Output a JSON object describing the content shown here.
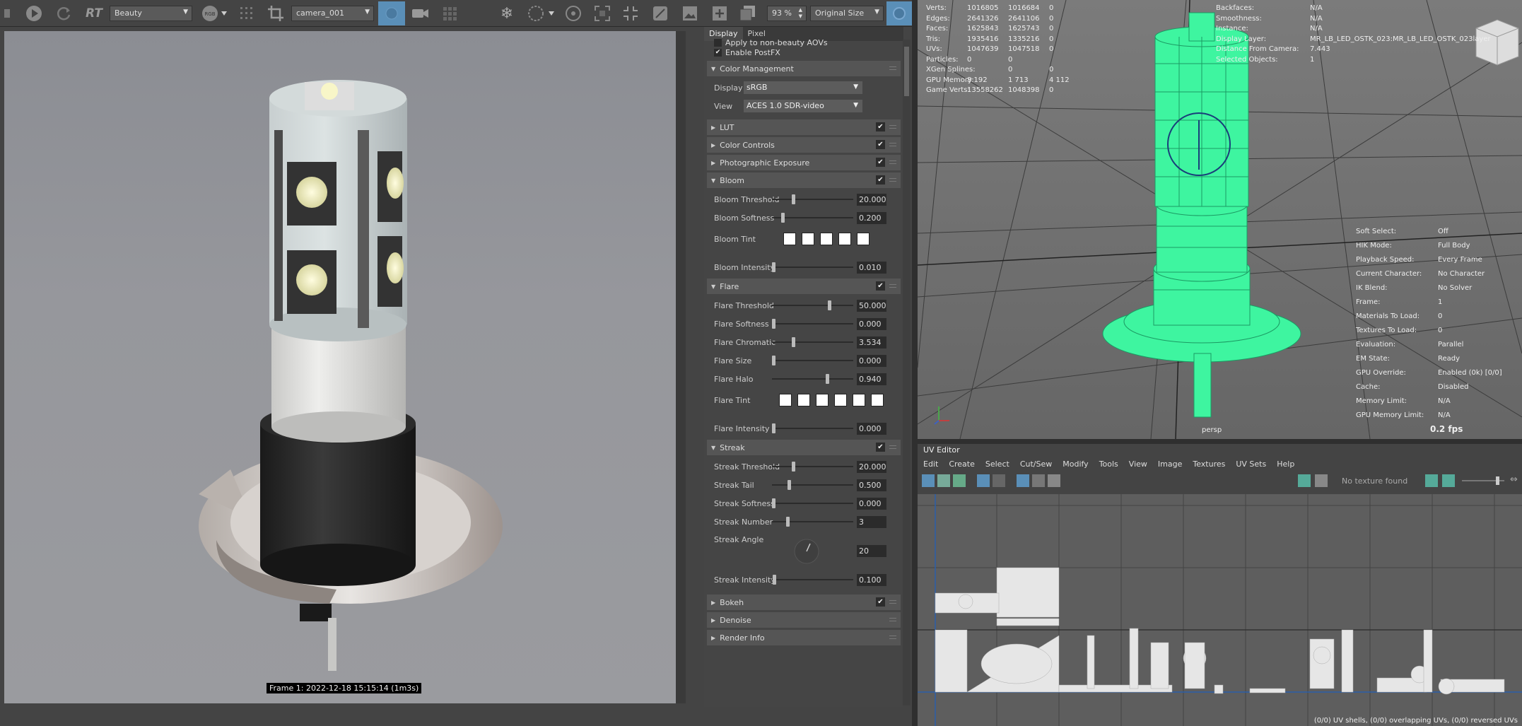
{
  "toolbar": {
    "renderer_label": "RT",
    "beauty": "Beauty",
    "rgb": "RGB",
    "camera": "camera_001",
    "zoom": "93 %",
    "size": "Original Size"
  },
  "render": {
    "caption": "Frame 1: 2022-12-18 15:15:14 (1m3s)"
  },
  "panel": {
    "tabs": [
      "Display",
      "Pixel"
    ],
    "apply_aovs": "Apply to non-beauty AOVs",
    "enable_postfx": "Enable PostFX",
    "color_management": "Color Management",
    "display_label": "Display",
    "display_value": "sRGB",
    "view_label": "View",
    "view_value": "ACES 1.0 SDR-video",
    "lut": "LUT",
    "color_controls": "Color Controls",
    "photo_exposure": "Photographic Exposure",
    "bloom": {
      "title": "Bloom",
      "threshold_label": "Bloom Threshold",
      "threshold": "20.000",
      "softness_label": "Bloom Softness",
      "softness": "0.200",
      "tint_label": "Bloom Tint",
      "intensity_label": "Bloom Intensity",
      "intensity": "0.010"
    },
    "flare": {
      "title": "Flare",
      "threshold_label": "Flare Threshold",
      "threshold": "50.000",
      "softness_label": "Flare Softness",
      "softness": "0.000",
      "chromatic_label": "Flare Chromatic",
      "chromatic": "3.534",
      "size_label": "Flare Size",
      "size": "0.000",
      "halo_label": "Flare Halo",
      "halo": "0.940",
      "tint_label": "Flare Tint",
      "intensity_label": "Flare Intensity",
      "intensity": "0.000"
    },
    "streak": {
      "title": "Streak",
      "threshold_label": "Streak Threshold",
      "threshold": "20.000",
      "tail_label": "Streak Tail",
      "tail": "0.500",
      "softness_label": "Streak Softness",
      "softness": "0.000",
      "number_label": "Streak Number",
      "number": "3",
      "angle_label": "Streak Angle",
      "angle": "20",
      "intensity_label": "Streak Intensity",
      "intensity": "0.100"
    },
    "bokeh": "Bokeh",
    "denoise": "Denoise",
    "render_info": "Render Info"
  },
  "sliders": {
    "bloom_threshold": 0.25,
    "bloom_softness": 0.12,
    "bloom_intensity": 0.0,
    "flare_threshold": 0.72,
    "flare_softness": 0.0,
    "flare_chromatic": 0.25,
    "flare_size": 0.0,
    "flare_halo": 0.69,
    "flare_intensity": 0.0,
    "streak_threshold": 0.25,
    "streak_tail": 0.2,
    "streak_softness": 0.0,
    "streak_number": 0.18,
    "streak_intensity": 0.01
  },
  "viewport": {
    "stats": [
      {
        "label": "Verts:",
        "a": "1016805",
        "b": "1016684",
        "c": "0"
      },
      {
        "label": "Edges:",
        "a": "2641326",
        "b": "2641106",
        "c": "0"
      },
      {
        "label": "Faces:",
        "a": "1625843",
        "b": "1625743",
        "c": "0"
      },
      {
        "label": "Tris:",
        "a": "1935416",
        "b": "1335216",
        "c": "0"
      },
      {
        "label": "UVs:",
        "a": "1047639",
        "b": "1047518",
        "c": "0"
      },
      {
        "label": "Particles:",
        "a": "0",
        "b": "0",
        "c": ""
      },
      {
        "label": "XGen Splines:",
        "a": "",
        "b": "0",
        "c": "0"
      },
      {
        "label": "GPU Memory:",
        "a": "8 192",
        "b": "1 713",
        "c": "4 112"
      },
      {
        "label": "Game Verts:",
        "a": "13558262",
        "b": "1048398",
        "c": "0"
      }
    ],
    "stats2": [
      {
        "label": "Backfaces:",
        "value": "N/A"
      },
      {
        "label": "Smoothness:",
        "value": "N/A"
      },
      {
        "label": "Instance:",
        "value": "N/A"
      },
      {
        "label": "Display Layer:",
        "value": "MR_LB_LED_OSTK_023:MR_LB_LED_OSTK_023layer"
      },
      {
        "label": "Distance From Camera:",
        "value": "7.443"
      },
      {
        "label": "Selected Objects:",
        "value": "1"
      }
    ],
    "info": [
      {
        "label": "Soft Select:",
        "value": "Off"
      },
      {
        "label": "HIK Mode:",
        "value": "Full Body"
      },
      {
        "label": "Playback Speed:",
        "value": "Every Frame"
      },
      {
        "label": "Current Character:",
        "value": "No Character"
      },
      {
        "label": "IK Blend:",
        "value": "No Solver"
      },
      {
        "label": "Frame:",
        "value": "1"
      },
      {
        "label": "Materials To Load:",
        "value": "0"
      },
      {
        "label": "Textures To Load:",
        "value": "0"
      },
      {
        "label": "Evaluation:",
        "value": "Parallel"
      },
      {
        "label": "EM State:",
        "value": "Ready"
      },
      {
        "label": "GPU Override:",
        "value": "Enabled (0k) [0/0]"
      },
      {
        "label": "Cache:",
        "value": "Disabled"
      },
      {
        "label": "Memory Limit:",
        "value": "N/A"
      },
      {
        "label": "GPU Memory Limit:",
        "value": "N/A"
      }
    ],
    "fps": "0.2 fps",
    "camera": "persp"
  },
  "uv": {
    "title": "UV Editor",
    "menu": [
      "Edit",
      "Create",
      "Select",
      "Cut/Sew",
      "Modify",
      "Tools",
      "View",
      "Image",
      "Textures",
      "UV Sets",
      "Help"
    ],
    "no_texture": "No texture found",
    "status": "(0/0) UV shells, (0/0) overlapping UVs, (0/0) reversed UVs"
  }
}
